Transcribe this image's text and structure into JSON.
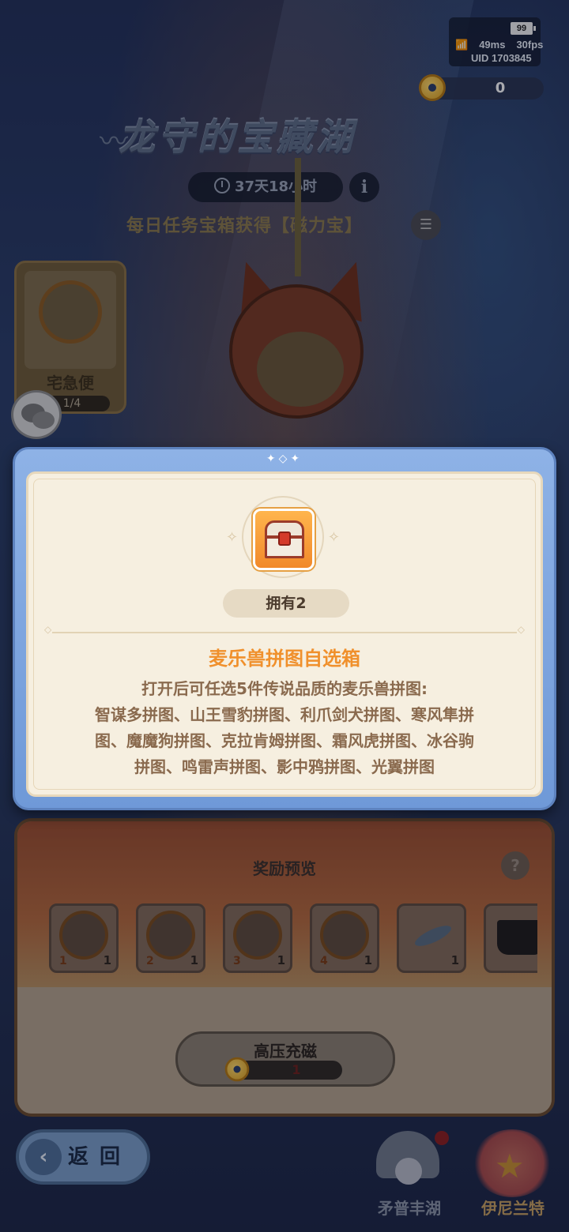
{
  "status": {
    "battery": "99",
    "ping": "49ms",
    "fps": "30fps",
    "uid_label": "UID",
    "uid": "1703845"
  },
  "currency": {
    "count": "0",
    "icon": "magnet-coin-icon"
  },
  "event": {
    "title": "龙守的宝藏湖",
    "timer": "37天18小时",
    "daily_tip": "每日任务宝箱获得【磁力宝】"
  },
  "express": {
    "label": "宅急便",
    "progress": "1/4"
  },
  "reward_panel": {
    "title": "奖励预览",
    "items": [
      {
        "index": "1",
        "qty": "1",
        "kind": "puzzle"
      },
      {
        "index": "2",
        "qty": "1",
        "kind": "puzzle"
      },
      {
        "index": "3",
        "qty": "1",
        "kind": "puzzle"
      },
      {
        "index": "4",
        "qty": "1",
        "kind": "puzzle"
      },
      {
        "index": "",
        "qty": "1",
        "kind": "fish"
      },
      {
        "index": "",
        "qty": "",
        "kind": "bag"
      }
    ],
    "charge_label": "高压充磁",
    "charge_value": "1"
  },
  "nav": {
    "back_label": "返回",
    "zone_left": "矛普丰湖",
    "zone_right": "伊尼兰特"
  },
  "modal": {
    "owned": "拥有2",
    "item_name": "麦乐兽拼图自选箱",
    "desc_line1": "打开后可任选5件传说品质的麦乐兽拼图:",
    "desc_line2": "智谋多拼图、山王雪豹拼图、利爪剑犬拼图、寒风隼拼",
    "desc_line3": "图、魔魔狗拼图、克拉肯姆拼图、霜风虎拼图、冰谷驹",
    "desc_line4": "拼图、鸣雷声拼图、影中鸦拼图、光翼拼图"
  },
  "colors": {
    "modal_frame": "#7ea6e0",
    "modal_paper": "#f6efe0",
    "item_name": "#f0902c",
    "desc_text": "#8a6a4e"
  }
}
